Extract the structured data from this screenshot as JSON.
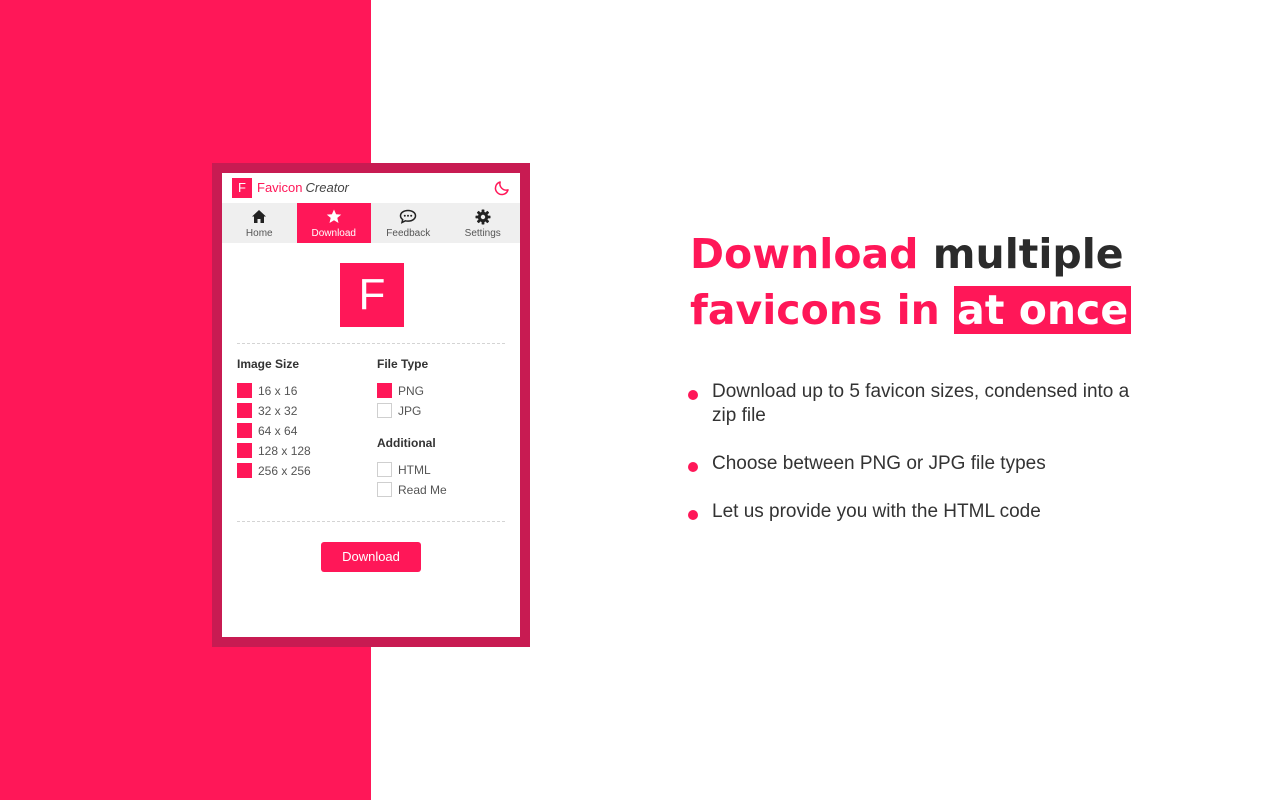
{
  "colors": {
    "accent": "#ff1758",
    "frame": "#c81b52",
    "tabs_bg": "#efefef"
  },
  "popup": {
    "logo_letter": "F",
    "brand_part1": "Favicon",
    "brand_part2": "Creator",
    "theme_icon": "moon-icon",
    "tabs": [
      {
        "label": "Home",
        "icon": "home-icon",
        "active": false
      },
      {
        "label": "Download",
        "icon": "star-icon",
        "active": true
      },
      {
        "label": "Feedback",
        "icon": "chat-bubble-icon",
        "active": false
      },
      {
        "label": "Settings",
        "icon": "gear-icon",
        "active": false
      }
    ],
    "preview_letter": "F",
    "image_size": {
      "title": "Image Size",
      "options": [
        {
          "label": "16 x 16",
          "checked": true
        },
        {
          "label": "32 x 32",
          "checked": true
        },
        {
          "label": "64 x 64",
          "checked": true
        },
        {
          "label": "128 x 128",
          "checked": true
        },
        {
          "label": "256 x 256",
          "checked": true
        }
      ]
    },
    "file_type": {
      "title": "File Type",
      "options": [
        {
          "label": "PNG",
          "checked": true
        },
        {
          "label": "JPG",
          "checked": false
        }
      ]
    },
    "additional": {
      "title": "Additional",
      "options": [
        {
          "label": "HTML",
          "checked": false
        },
        {
          "label": "Read Me",
          "checked": false
        }
      ]
    },
    "download_label": "Download"
  },
  "marketing": {
    "headline_pink": "Download",
    "headline_dark1": " multiple",
    "headline_pink2": "favicons in",
    "headline_highlight": "at once",
    "bullets": [
      "Download up to 5 favicon sizes, condensed into a zip file",
      "Choose between PNG or JPG file types",
      "Let us provide you with the HTML code"
    ]
  }
}
